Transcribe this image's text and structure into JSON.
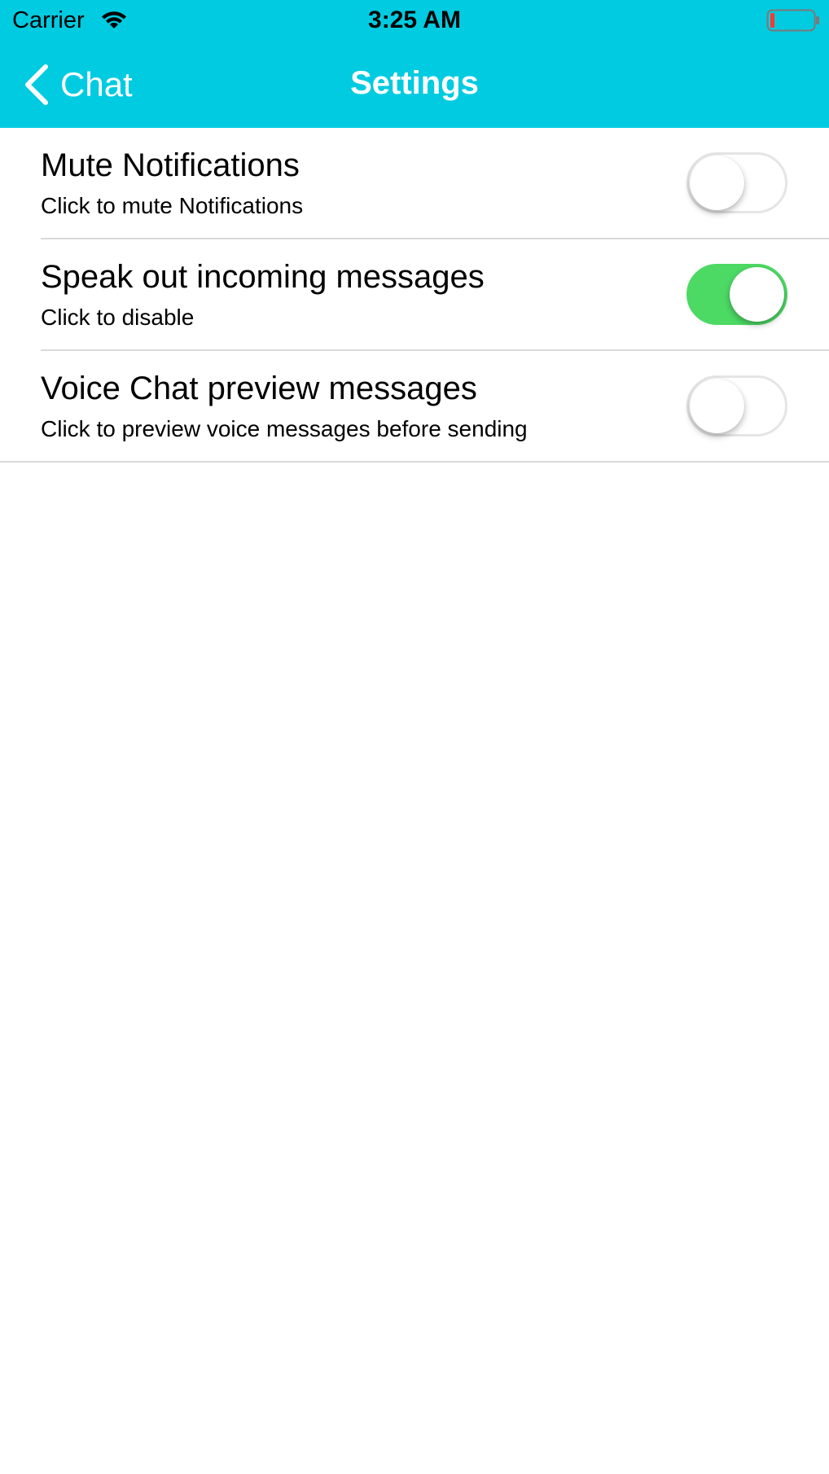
{
  "status_bar": {
    "carrier": "Carrier",
    "time": "3:25 AM",
    "wifi_icon": "wifi-icon",
    "battery_icon": "battery-low-icon",
    "battery_level_fraction": 0.1
  },
  "nav": {
    "back_label": "Chat",
    "back_icon": "chevron-left-icon",
    "title": "Settings",
    "bar_color": "#00cbe0"
  },
  "settings": [
    {
      "title": "Mute Notifications",
      "subtitle": "Click to mute Notifications",
      "enabled": false
    },
    {
      "title": "Speak out incoming messages",
      "subtitle": "Click to disable",
      "enabled": true
    },
    {
      "title": "Voice Chat preview messages",
      "subtitle": "Click to preview voice messages before sending",
      "enabled": false
    }
  ],
  "colors": {
    "toggle_on": "#4cd964",
    "toggle_off_border": "#e5e5e5",
    "separator": "#d9d9d9"
  }
}
